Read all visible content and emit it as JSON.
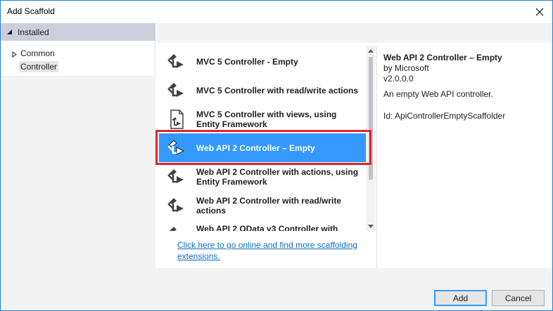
{
  "window": {
    "title": "Add Scaffold"
  },
  "left_tree": {
    "header": "Installed",
    "items": [
      {
        "label": "Common",
        "expandable": true
      },
      {
        "label": "Controller",
        "expandable": false,
        "selected": true
      }
    ]
  },
  "scaffolds": [
    {
      "label": "MVC 5 Controller - Empty",
      "icon": "controller-icon",
      "selected": false
    },
    {
      "label": "MVC 5 Controller with read/write actions",
      "icon": "controller-icon",
      "selected": false
    },
    {
      "label": "MVC 5 Controller with views, using Entity Framework",
      "icon": "views-controller-icon",
      "selected": false
    },
    {
      "label": "Web API 2 Controller – Empty",
      "icon": "controller-icon",
      "selected": true
    },
    {
      "label": "Web API 2 Controller with actions, using Entity Framework",
      "icon": "controller-icon",
      "selected": false
    },
    {
      "label": "Web API 2 Controller with read/write actions",
      "icon": "controller-icon",
      "selected": false
    },
    {
      "label": "Web API 2 OData v3 Controller with",
      "icon": "controller-icon",
      "selected": false
    }
  ],
  "online_link": "Click here to go online and find more scaffolding extensions.",
  "details": {
    "title": "Web API 2 Controller – Empty",
    "author": "by Microsoft",
    "version": "v2.0.0.0",
    "description": "An empty Web API controller.",
    "id": "Id: ApiControllerEmptyScaffolder"
  },
  "buttons": {
    "add": "Add",
    "cancel": "Cancel"
  },
  "colors": {
    "accent": "#3399ff",
    "highlight_outline": "#e0242b",
    "link": "#0e70c0"
  }
}
